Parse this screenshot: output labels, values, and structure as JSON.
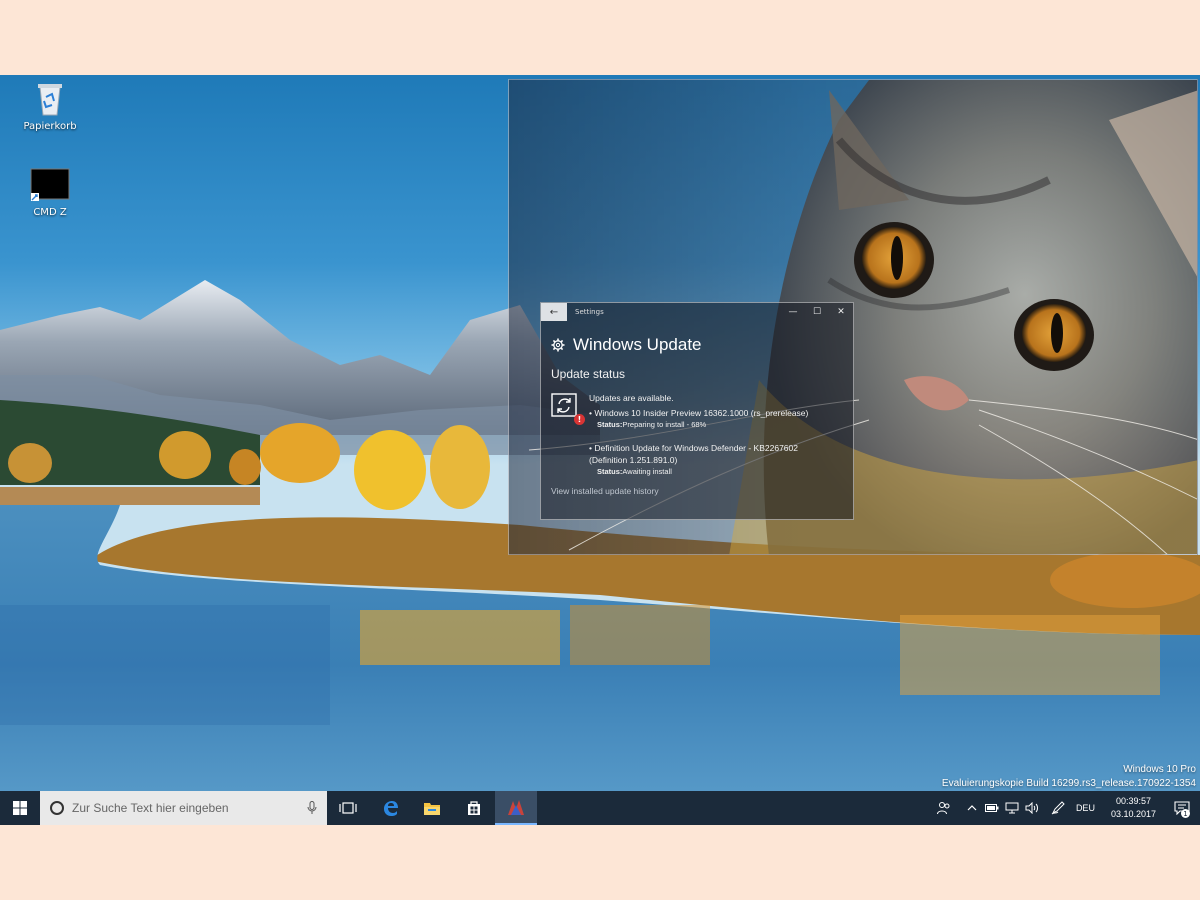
{
  "desktop": {
    "icons": [
      {
        "label": "Papierkorb",
        "icon": "recycle-bin-icon"
      },
      {
        "label": "CMD Z",
        "icon": "shortcut-icon"
      }
    ]
  },
  "settings_window": {
    "title": "Settings",
    "heading": "Windows Update",
    "section": "Update status",
    "available_text": "Updates are available.",
    "updates": [
      {
        "name": "• Windows 10 Insider Preview 16362.1000 (rs_prerelease)",
        "status_label": "Status:",
        "status_value": "Preparing to install - 68%"
      },
      {
        "name": "• Definition Update for Windows Defender - KB2267602",
        "name_line2": "(Definition 1.251.891.0)",
        "status_label": "Status:",
        "status_value": "Awaiting install"
      }
    ],
    "history_link": "View installed update history",
    "controls": {
      "back": "←",
      "minimize": "—",
      "maximize": "☐",
      "close": "✕"
    }
  },
  "watermark": {
    "edition": "Windows 10 Pro",
    "build": "Evaluierungskopie Build 16299.rs3_release.170922-1354"
  },
  "taskbar": {
    "search_placeholder": "Zur Suche Text hier eingeben",
    "language": "DEU",
    "time": "00:39:57",
    "date": "03.10.2017",
    "notification_count": "1"
  },
  "colors": {
    "taskbar": "#1b2a3a",
    "badge_red": "#d83434",
    "page_bg": "#fde6d6"
  }
}
